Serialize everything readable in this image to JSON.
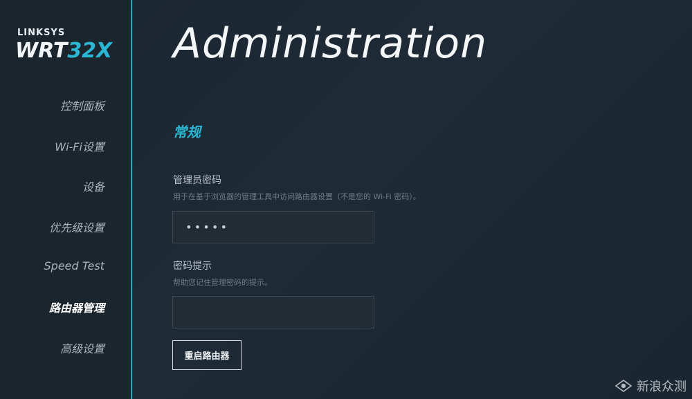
{
  "brand": {
    "company": "LINKSYS",
    "model_main": "WRT",
    "model_accent": "32X"
  },
  "sidebar": {
    "items": [
      {
        "label": "控制面板",
        "active": false
      },
      {
        "label": "Wi-Fi设置",
        "active": false
      },
      {
        "label": "设备",
        "active": false
      },
      {
        "label": "优先级设置",
        "active": false
      },
      {
        "label": "Speed Test",
        "active": false
      },
      {
        "label": "路由器管理",
        "active": true
      },
      {
        "label": "高级设置",
        "active": false
      }
    ]
  },
  "main": {
    "title": "Administration",
    "section_title": "常规",
    "admin_password": {
      "label": "管理员密码",
      "hint": "用于在基于浏览器的管理工具中访问路由器设置（不是您的 Wi-Fi 密码）。",
      "value": "•••••"
    },
    "password_hint": {
      "label": "密码提示",
      "hint": "帮助您记住管理密码的提示。",
      "value": ""
    },
    "reboot_button": "重启路由器"
  },
  "watermark": {
    "text": "新浪众测",
    "icon": "sina-eye-icon"
  },
  "colors": {
    "accent": "#2bb7d3",
    "background": "#1b2630"
  }
}
